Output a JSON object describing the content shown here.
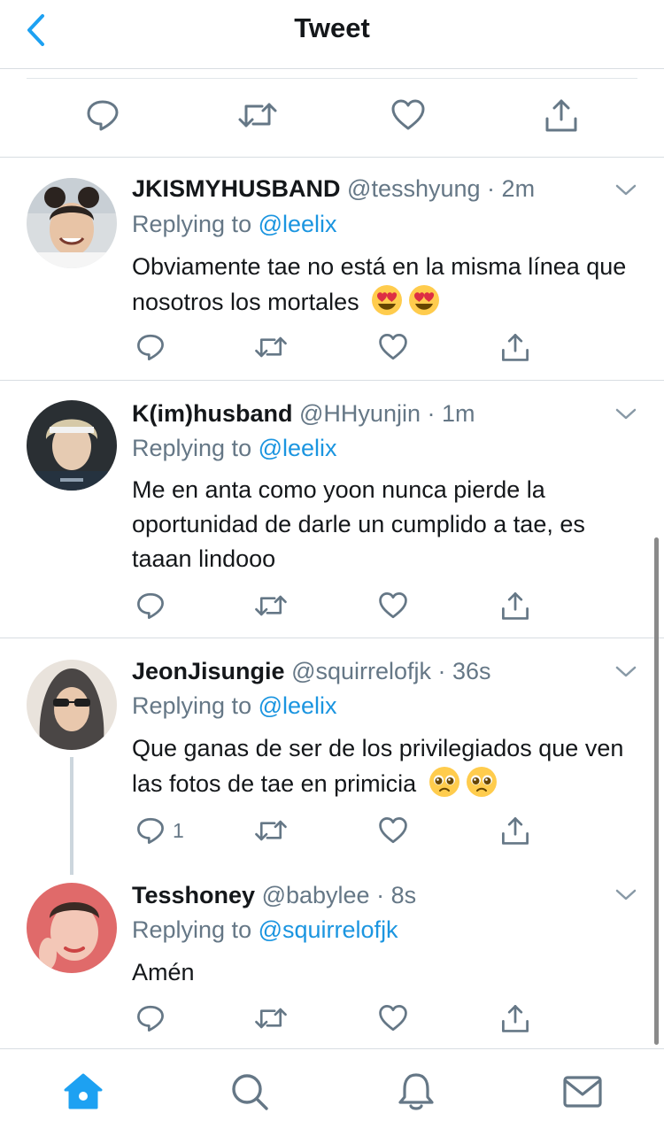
{
  "header": {
    "title": "Tweet",
    "back_icon": "chevron-left-icon"
  },
  "colors": {
    "accent": "#1da1f2",
    "mention": "#1b95e0",
    "muted": "#657786",
    "divider": "#d8dde2"
  },
  "main_actions": [
    "reply-icon",
    "retweet-icon",
    "like-icon",
    "share-icon"
  ],
  "replies": [
    {
      "name": "JKISMYHUSBAND",
      "handle": "@tesshyung",
      "time": "2m",
      "replying_prefix": "Replying to",
      "replying_to": "@leelix",
      "text": "Obviamente tae no está en la misma línea que nosotros los mortales",
      "emojis": [
        "heart-eyes-emoji",
        "heart-eyes-emoji"
      ],
      "reply_count": ""
    },
    {
      "name": "K(im)husband",
      "handle": "@HHyunjin",
      "time": "1m",
      "replying_prefix": "Replying to",
      "replying_to": "@leelix",
      "text": "Me en anta como yoon nunca pierde la oportunidad de darle un cumplido a tae, es taaan lindooo",
      "emojis": [],
      "reply_count": ""
    },
    {
      "name": "JeonJisungie",
      "handle": "@squirrelofjk",
      "time": "36s",
      "replying_prefix": "Replying to",
      "replying_to": "@leelix",
      "text": "Que ganas de ser de los privilegiados que ven las fotos de tae en primicia",
      "emojis": [
        "pleading-face-emoji",
        "pleading-face-emoji"
      ],
      "reply_count": "1"
    },
    {
      "name": "Tesshoney",
      "handle": "@babylee",
      "time": "8s",
      "replying_prefix": "Replying to",
      "replying_to": "@squirrelofjk",
      "text": "Amén",
      "emojis": [],
      "reply_count": ""
    }
  ],
  "tabbar": [
    "home-icon",
    "search-icon",
    "notifications-icon",
    "messages-icon"
  ]
}
